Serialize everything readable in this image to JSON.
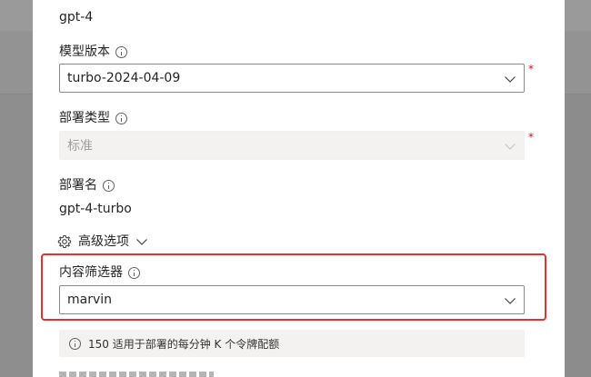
{
  "model": {
    "name_value": "gpt-4"
  },
  "model_version": {
    "label": "模型版本",
    "value": "turbo-2024-04-09",
    "required_mark": "*"
  },
  "deployment_type": {
    "label": "部署类型",
    "value": "标准",
    "required_mark": "*",
    "disabled": true
  },
  "deployment_name": {
    "label": "部署名",
    "value": "gpt-4-turbo"
  },
  "advanced": {
    "label": "高级选项"
  },
  "content_filter": {
    "label": "内容筛选器",
    "value": "marvin"
  },
  "notice": {
    "text": "150 适用于部署的每分钟 K 个令牌配额"
  },
  "colors": {
    "highlight_border": "#e8312f",
    "required": "#c50f1f"
  },
  "icons": [
    "info-icon",
    "chevron-down-icon",
    "gear-icon"
  ]
}
